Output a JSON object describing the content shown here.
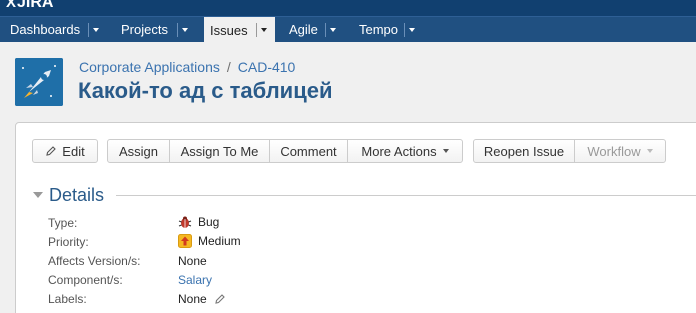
{
  "header": {
    "logo": "JIRA",
    "logo_mark": "X"
  },
  "nav": {
    "items": [
      {
        "label": "Dashboards"
      },
      {
        "label": "Projects"
      },
      {
        "label": "Issues"
      },
      {
        "label": "Agile"
      },
      {
        "label": "Tempo"
      }
    ],
    "active": "Issues"
  },
  "issue": {
    "project": "Corporate Applications",
    "separator": "/",
    "key": "CAD-410",
    "title": "Какой-то ад с таблицей",
    "avatar_icon": "rocket-icon"
  },
  "toolbar": {
    "edit": "Edit",
    "assign": "Assign",
    "assign_to_me": "Assign To Me",
    "comment": "Comment",
    "more_actions": "More Actions",
    "reopen": "Reopen Issue",
    "workflow": "Workflow"
  },
  "details": {
    "title": "Details",
    "fields": [
      {
        "label": "Type:",
        "value": "Bug",
        "icon": "bug-icon"
      },
      {
        "label": "Priority:",
        "value": "Medium",
        "icon": "priority-medium-icon"
      },
      {
        "label": "Affects Version/s:",
        "value": "None"
      },
      {
        "label": "Component/s:",
        "value": "Salary"
      },
      {
        "label": "Labels:",
        "value": "None",
        "icon": "pencil-icon"
      }
    ]
  },
  "colors": {
    "nav_bg": "#205081",
    "header_bg": "#114070",
    "link": "#3b73af",
    "title": "#2a5b8a"
  }
}
